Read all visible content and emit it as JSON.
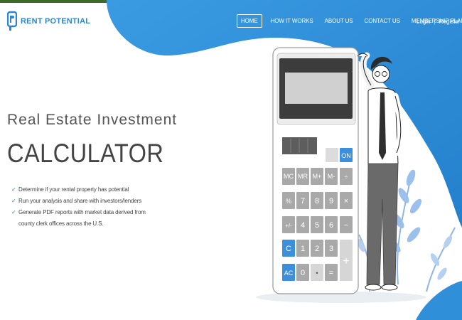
{
  "brand": {
    "name": "RENT POTENTIAL"
  },
  "nav": {
    "items": [
      {
        "label": "HOME",
        "active": true
      },
      {
        "label": "HOW IT WORKS",
        "active": false
      },
      {
        "label": "ABOUT US",
        "active": false
      },
      {
        "label": "CONTACT US",
        "active": false
      },
      {
        "label": "MEMBERSHIP PLANS ▾",
        "active": false
      }
    ],
    "login": "Login",
    "separator": "|",
    "register": "Register"
  },
  "hero": {
    "subtitle": "Real Estate Investment",
    "title": "CALCULATOR",
    "features": [
      "Determine if your rental property has potential",
      "Run your analysis and share with investors/lenders",
      "Generate PDF reports with market data derived from county clerk offices across the U.S."
    ]
  },
  "calculator": {
    "keys": {
      "on": "ON",
      "mc": "MC",
      "mr": "MR",
      "mplus": "M+",
      "mminus": "M-",
      "div": "÷",
      "pct": "%",
      "k7": "7",
      "k8": "8",
      "k9": "9",
      "mul": "×",
      "pm": "+/-",
      "k4": "4",
      "k5": "5",
      "k6": "6",
      "minus": "−",
      "c": "C",
      "k1": "1",
      "k2": "2",
      "k3": "3",
      "plus": "+",
      "ac": "AC",
      "k0": "0",
      "dot": "•",
      "eq": "="
    }
  },
  "colors": {
    "brand_blue": "#2c86cf",
    "wave_blue": "#2f8fd8",
    "key_blue": "#3b8fdc",
    "key_gray": "#a9a9a9",
    "text_dark": "#444444"
  }
}
